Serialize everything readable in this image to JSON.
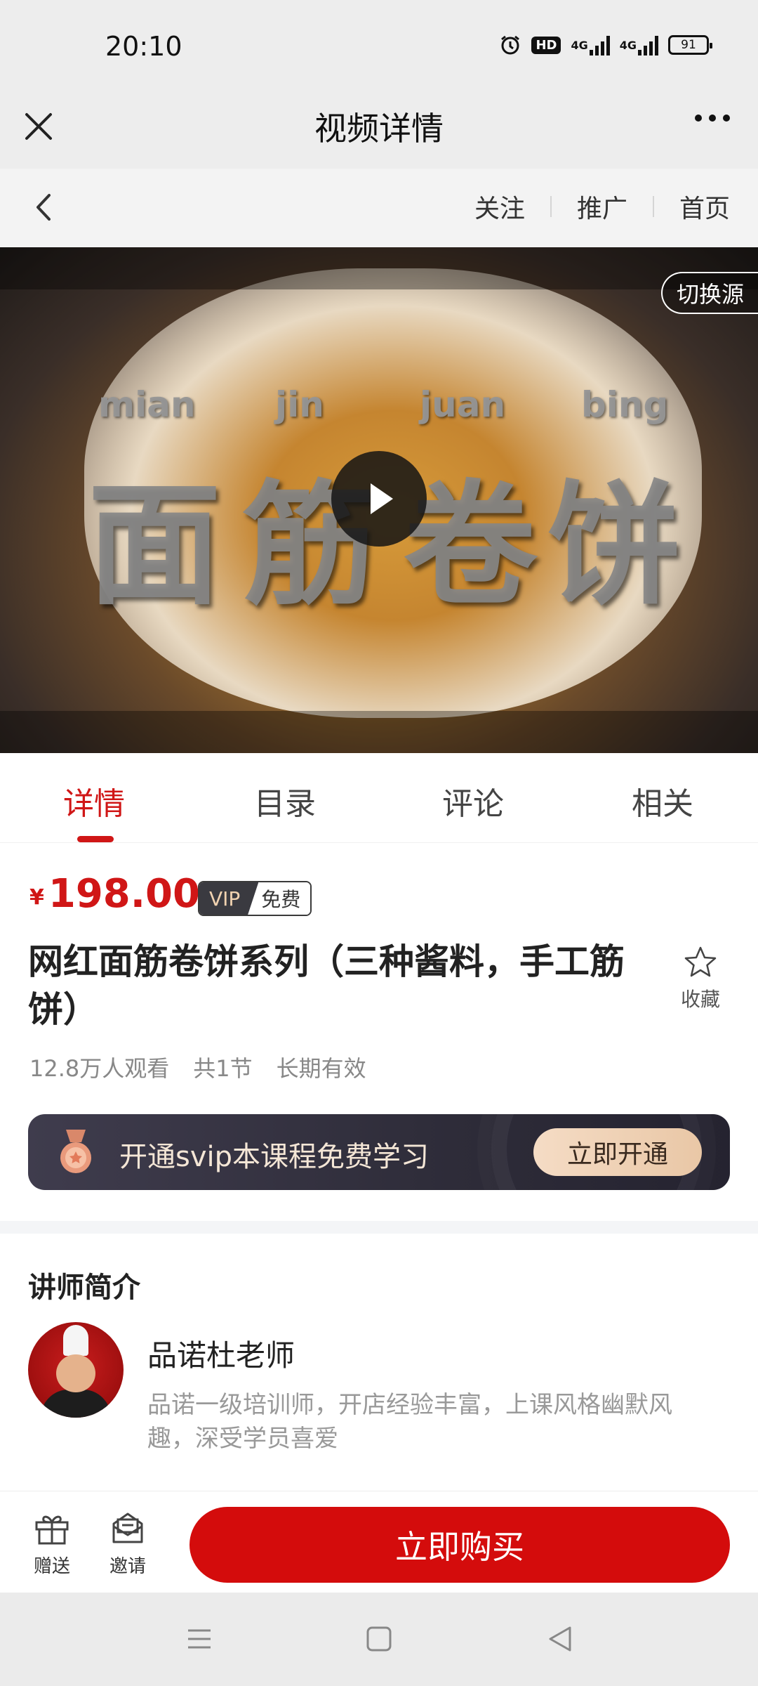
{
  "status_bar": {
    "time": "20:10",
    "hd_label": "HD",
    "signal1_label": "4G",
    "signal2_label": "4G",
    "battery": "91"
  },
  "header": {
    "title": "视频详情"
  },
  "subnav": {
    "follow": "关注",
    "promote": "推广",
    "home": "首页"
  },
  "video": {
    "switch_source": "切换源",
    "pinyin": [
      "mian",
      "jin",
      "juan",
      "bing"
    ],
    "title_chars": [
      "面",
      "筋",
      "卷",
      "饼"
    ]
  },
  "tabs": [
    {
      "label": "详情",
      "active": true
    },
    {
      "label": "目录",
      "active": false
    },
    {
      "label": "评论",
      "active": false
    },
    {
      "label": "相关",
      "active": false
    }
  ],
  "course": {
    "currency": "¥",
    "price": "198.00",
    "vip_label": "VIP",
    "free_label": "免费",
    "title": "网红面筋卷饼系列（三种酱料，手工筋饼）",
    "favorite_label": "收藏",
    "viewers": "12.8万人观看",
    "lessons": "共1节",
    "validity": "长期有效"
  },
  "svip_banner": {
    "text": "开通svip本课程免费学习",
    "button": "立即开通"
  },
  "teacher": {
    "section_title": "讲师简介",
    "name": "品诺杜老师",
    "description": "品诺一级培训师，开店经验丰富，上课风格幽默风趣，深受学员喜爱"
  },
  "bottom_bar": {
    "gift": "赠送",
    "invite": "邀请",
    "buy": "立即购买"
  },
  "colors": {
    "accent": "#d01616",
    "buy_button": "#d40c0c",
    "svip_bg": "#3f3c4d",
    "svip_button": "#f5dcc5"
  }
}
